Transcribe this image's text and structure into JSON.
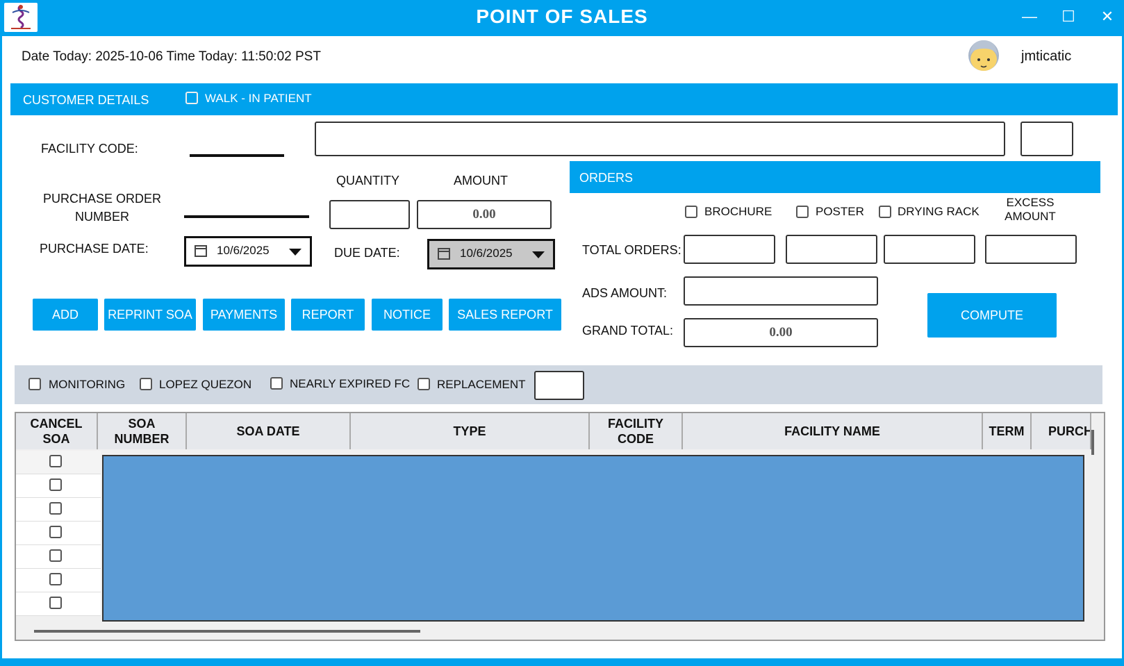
{
  "window": {
    "title": "POINT OF SALES",
    "minimize": "—",
    "maximize": "☐",
    "close": "✕"
  },
  "header": {
    "datetime": "Date Today: 2025-10-06 Time Today: 11:50:02 PST",
    "username": "jmticatic"
  },
  "customer": {
    "section_label": "CUSTOMER DETAILS",
    "walkin_label": "WALK - IN PATIENT",
    "facility_code_label": "FACILITY CODE:",
    "po_label_line1": "PURCHASE ORDER",
    "po_label_line2": "NUMBER",
    "purchase_date_label": "PURCHASE DATE:",
    "purchase_date_value": "10/6/2025",
    "quantity_label": "QUANTITY",
    "amount_label": "AMOUNT",
    "amount_value": "0.00",
    "due_date_label": "DUE DATE:",
    "due_date_value": "10/6/2025"
  },
  "orders": {
    "section_label": "ORDERS",
    "brochure_label": "BROCHURE",
    "poster_label": "POSTER",
    "drying_rack_label": "DRYING RACK",
    "excess_label_line1": "EXCESS",
    "excess_label_line2": "AMOUNT",
    "total_orders_label": "TOTAL ORDERS:",
    "ads_amount_label": "ADS AMOUNT:",
    "grand_total_label": "GRAND TOTAL:",
    "grand_total_value": "0.00",
    "compute_label": "COMPUTE"
  },
  "actions": {
    "add": "ADD",
    "reprint_soa": "REPRINT SOA",
    "payments": "PAYMENTS",
    "report": "REPORT",
    "notice": "NOTICE",
    "sales_report": "SALES REPORT"
  },
  "filters": {
    "monitoring": "MONITORING",
    "lopez_quezon": "LOPEZ QUEZON",
    "nearly_expired": "NEARLY EXPIRED FC",
    "replacement": "REPLACEMENT"
  },
  "table": {
    "columns": [
      {
        "line1": "CANCEL",
        "line2": "SOA"
      },
      {
        "line1": "SOA",
        "line2": "NUMBER"
      },
      {
        "line1": "SOA DATE",
        "line2": ""
      },
      {
        "line1": "TYPE",
        "line2": ""
      },
      {
        "line1": "FACILITY",
        "line2": "CODE"
      },
      {
        "line1": "FACILITY NAME",
        "line2": ""
      },
      {
        "line1": "TERM",
        "line2": ""
      },
      {
        "line1": "PURCH",
        "line2": ""
      }
    ]
  },
  "icons": {
    "avatar": "avatar-icon",
    "calendar": "calendar-icon",
    "dropdown": "chevron-down-icon"
  },
  "colors": {
    "accent": "#00a2ed",
    "selection": "#5b9bd5",
    "filter_bar": "#d0d8e2"
  }
}
